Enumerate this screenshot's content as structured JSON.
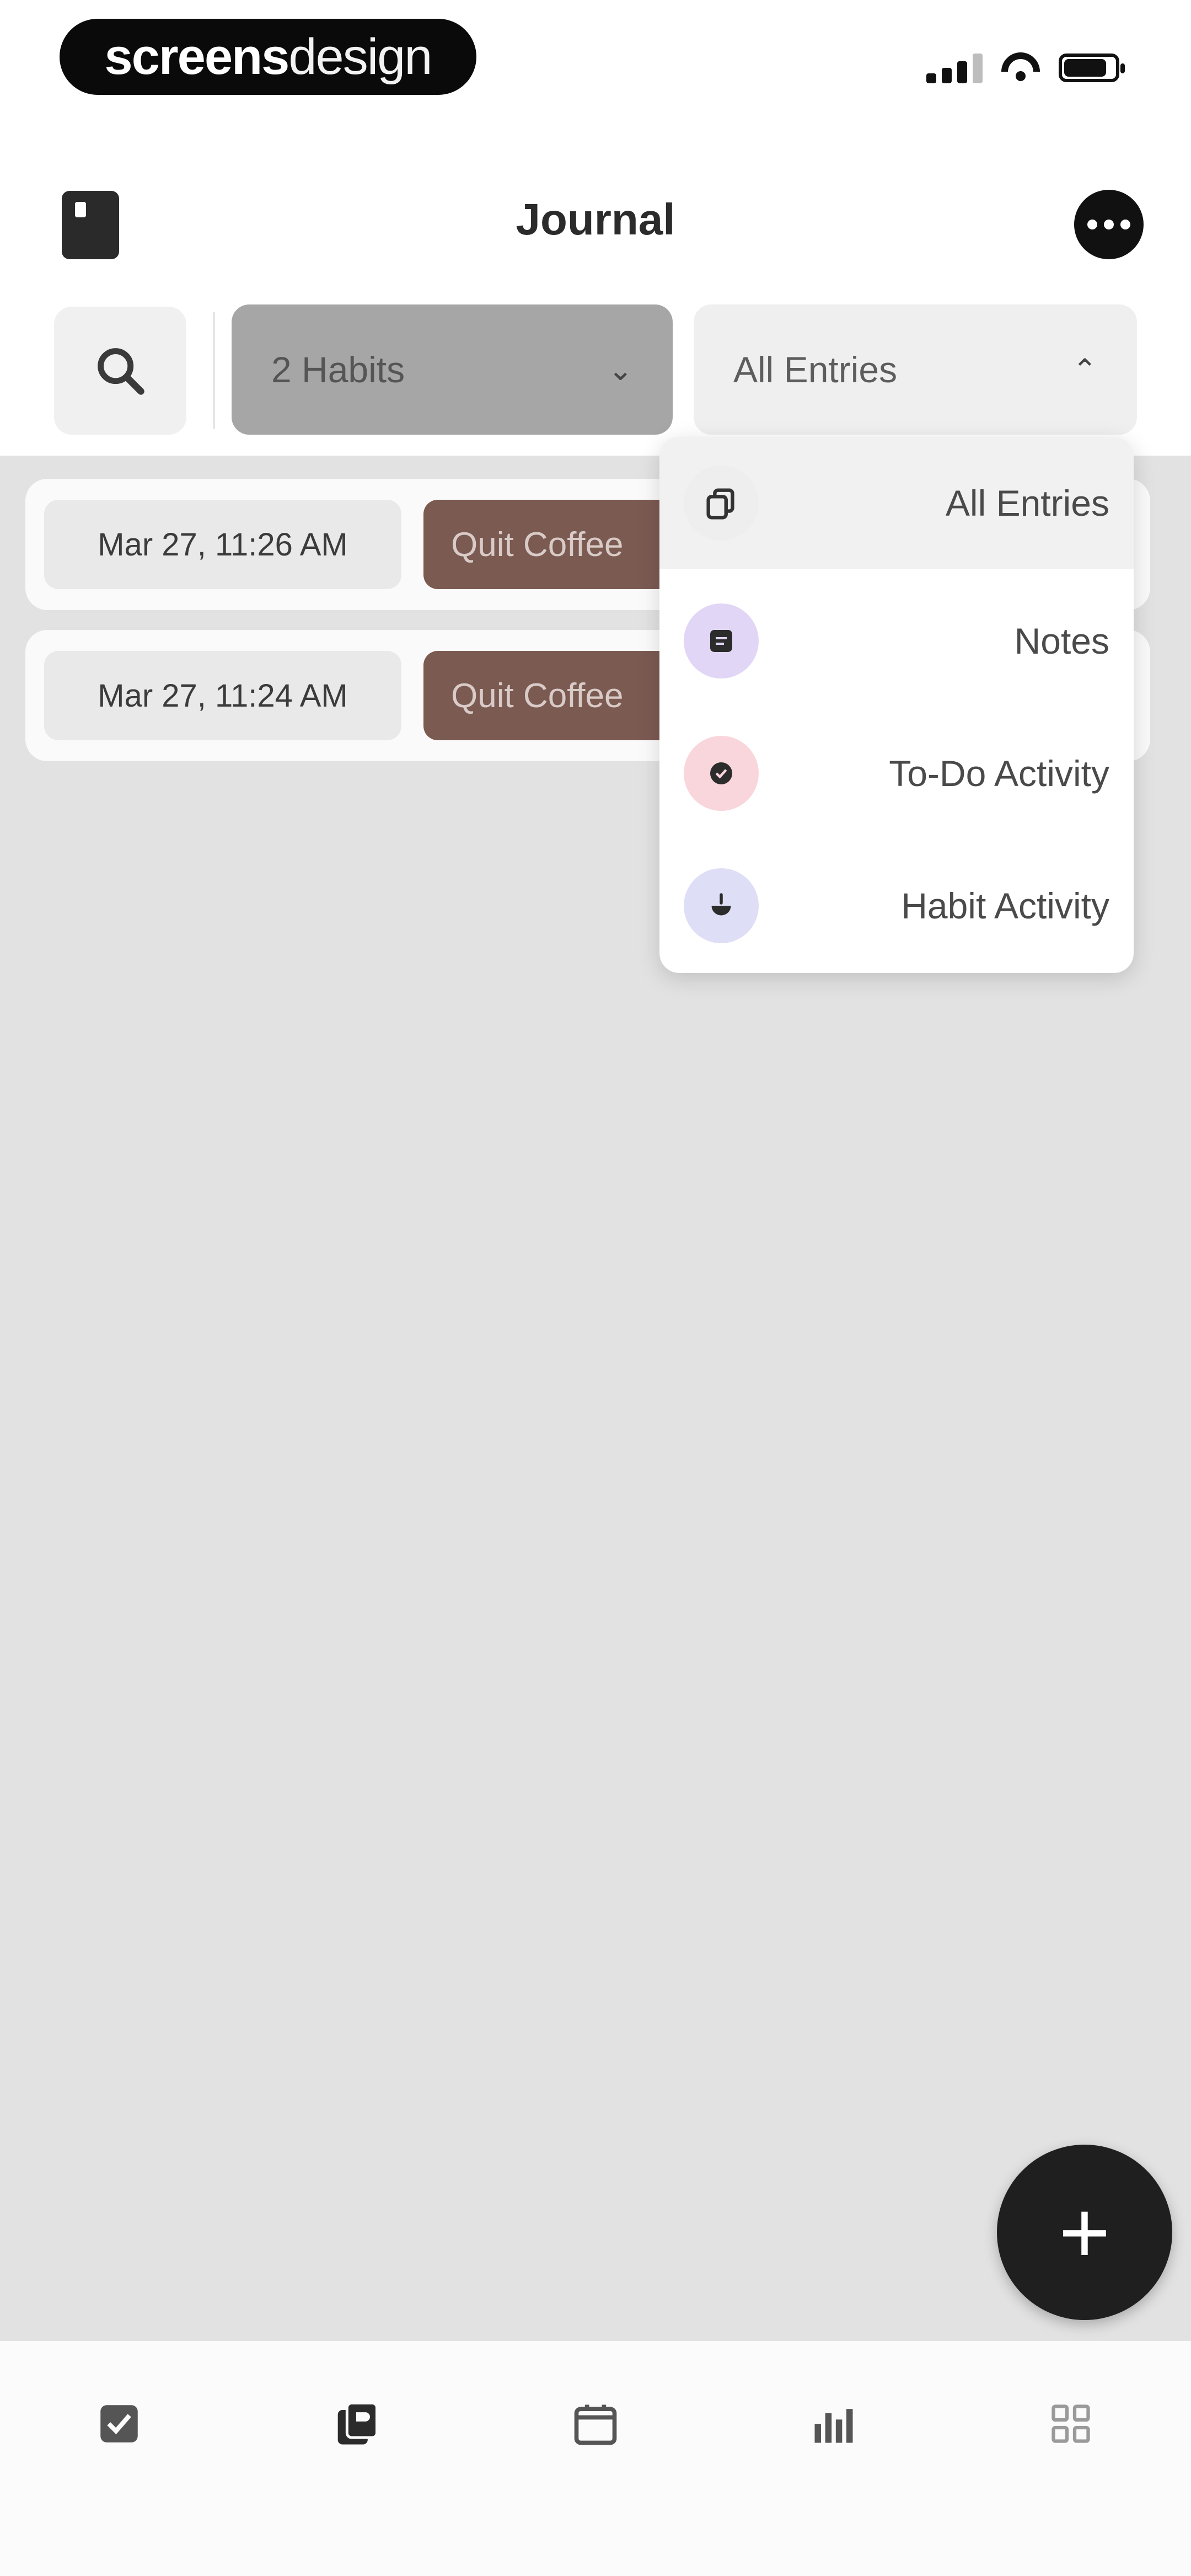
{
  "status_bar": {
    "watermark_bold": "screens",
    "watermark_thin": "design"
  },
  "header": {
    "title": "Journal",
    "left_icon": "journal-book-icon",
    "right_icon": "more-icon"
  },
  "filters": {
    "search_icon": "search-icon",
    "habits_label": "2 Habits",
    "entries_label": "All Entries"
  },
  "entries": [
    {
      "date": "Mar 27, 11:26 AM",
      "habit": "Quit Coffee"
    },
    {
      "date": "Mar 27, 11:24 AM",
      "habit": "Quit Coffee"
    }
  ],
  "dropdown": {
    "items": [
      {
        "label": "All Entries",
        "icon": "copy-icon",
        "active": true,
        "icon_bg": "#eeeeee"
      },
      {
        "label": "Notes",
        "icon": "note-icon",
        "active": false,
        "icon_bg": "#e2d6f6"
      },
      {
        "label": "To-Do Activity",
        "icon": "todo-icon",
        "active": false,
        "icon_bg": "#f9d5dc"
      },
      {
        "label": "Habit Activity",
        "icon": "habit-icon",
        "active": false,
        "icon_bg": "#dedef6"
      }
    ]
  },
  "fab": {
    "label": "+"
  },
  "bottom_nav": {
    "items": [
      {
        "icon": "checkbox-icon"
      },
      {
        "icon": "journal-icon"
      },
      {
        "icon": "calendar-icon"
      },
      {
        "icon": "stats-icon"
      },
      {
        "icon": "grid-icon"
      }
    ]
  },
  "colors": {
    "habit_pill": "#7b5a52",
    "content_bg": "#e2e2e2",
    "fab": "#1f1f1f"
  }
}
